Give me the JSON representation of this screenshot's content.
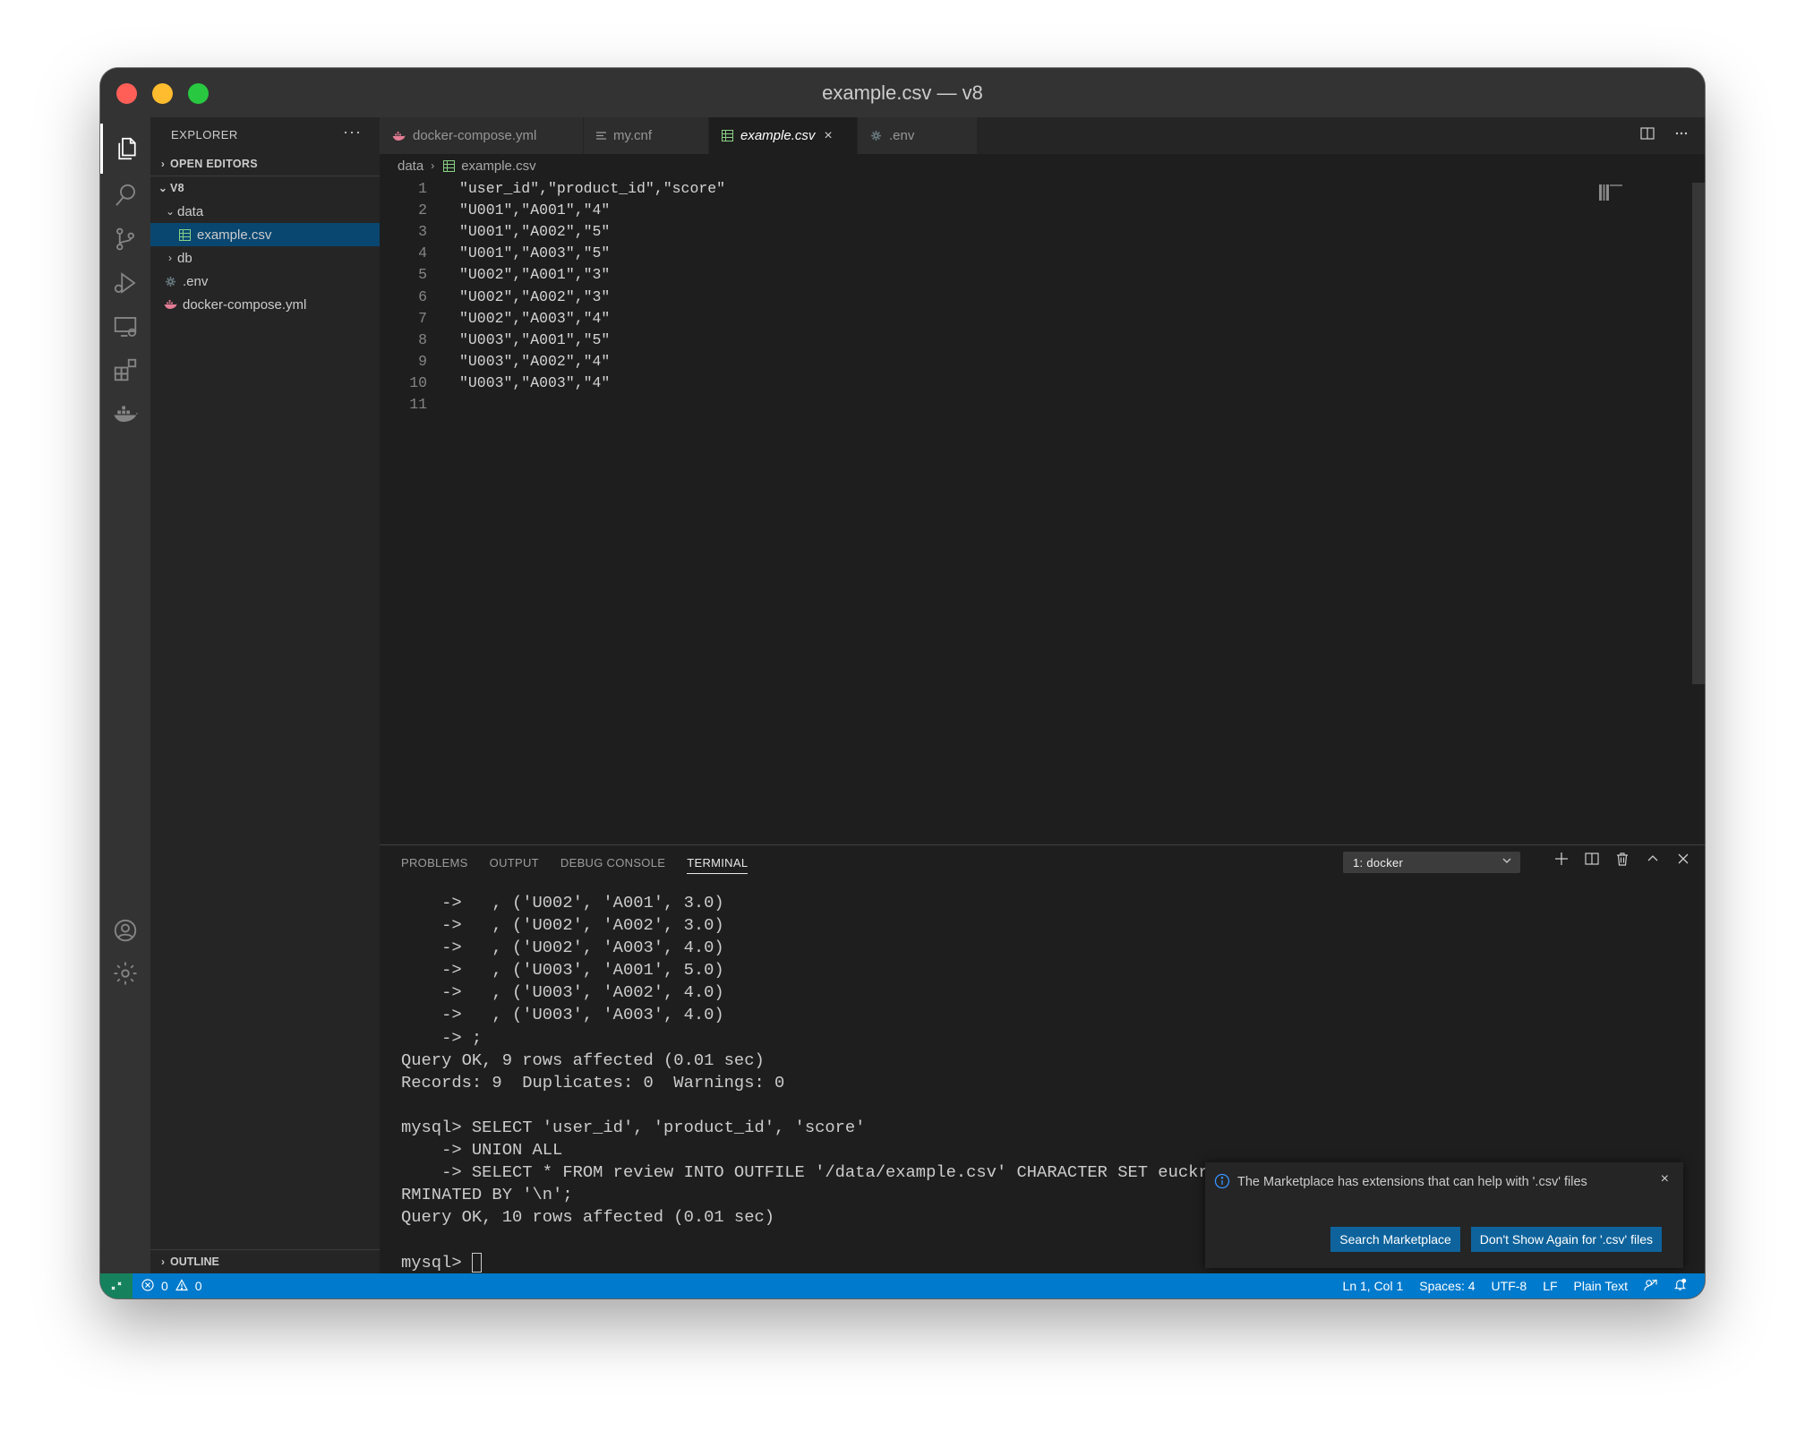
{
  "window": {
    "title": "example.csv — v8"
  },
  "sidebar": {
    "header": "EXPLORER",
    "more": "···",
    "open_editors": "OPEN EDITORS",
    "workspace": "V8",
    "tree": [
      {
        "label": "data",
        "type": "folder",
        "expanded": true
      },
      {
        "label": "example.csv",
        "type": "csv",
        "selected": true
      },
      {
        "label": "db",
        "type": "folder",
        "expanded": false
      },
      {
        "label": ".env",
        "type": "gear"
      },
      {
        "label": "docker-compose.yml",
        "type": "docker"
      }
    ],
    "outline": "OUTLINE"
  },
  "tabs": [
    {
      "label": "docker-compose.yml",
      "icon": "docker-icon"
    },
    {
      "label": "my.cnf",
      "icon": "lines-icon"
    },
    {
      "label": "example.csv",
      "icon": "csv-icon",
      "active": true,
      "close": "×"
    },
    {
      "label": ".env",
      "icon": "gear-icon"
    }
  ],
  "breadcrumb": {
    "folder": "data",
    "file": "example.csv"
  },
  "editor": {
    "lines": [
      {
        "n": "1",
        "text": "\"user_id\",\"product_id\",\"score\""
      },
      {
        "n": "2",
        "text": "\"U001\",\"A001\",\"4\""
      },
      {
        "n": "3",
        "text": "\"U001\",\"A002\",\"5\""
      },
      {
        "n": "4",
        "text": "\"U001\",\"A003\",\"5\""
      },
      {
        "n": "5",
        "text": "\"U002\",\"A001\",\"3\""
      },
      {
        "n": "6",
        "text": "\"U002\",\"A002\",\"3\""
      },
      {
        "n": "7",
        "text": "\"U002\",\"A003\",\"4\""
      },
      {
        "n": "8",
        "text": "\"U003\",\"A001\",\"5\""
      },
      {
        "n": "9",
        "text": "\"U003\",\"A002\",\"4\""
      },
      {
        "n": "10",
        "text": "\"U003\",\"A003\",\"4\""
      },
      {
        "n": "11",
        "text": ""
      }
    ]
  },
  "panel": {
    "tabs": [
      {
        "label": "PROBLEMS"
      },
      {
        "label": "OUTPUT"
      },
      {
        "label": "DEBUG CONSOLE"
      },
      {
        "label": "TERMINAL",
        "active": true
      }
    ],
    "terminal_select": "1: docker",
    "terminal_lines": [
      "    ->   , ('U002', 'A001', 3.0)",
      "    ->   , ('U002', 'A002', 3.0)",
      "    ->   , ('U002', 'A003', 4.0)",
      "    ->   , ('U003', 'A001', 5.0)",
      "    ->   , ('U003', 'A002', 4.0)",
      "    ->   , ('U003', 'A003', 4.0)",
      "    -> ;",
      "Query OK, 9 rows affected (0.01 sec)",
      "Records: 9  Duplicates: 0  Warnings: 0",
      "",
      "mysql> SELECT 'user_id', 'product_id', 'score'",
      "    -> UNION ALL",
      "    -> SELECT * FROM review INTO OUTFILE '/data/example.csv' CHARACTER SET euckr FIE",
      "RMINATED BY '\\n';",
      "Query OK, 10 rows affected (0.01 sec)",
      ""
    ],
    "prompt": "mysql> "
  },
  "notification": {
    "message": "The Marketplace has extensions that can help with '.csv' files",
    "button_search": "Search Marketplace",
    "button_dont_show": "Don't Show Again for '.csv' files",
    "close": "×"
  },
  "statusbar": {
    "errors": "0",
    "warnings": "0",
    "position": "Ln 1, Col 1",
    "spaces": "Spaces: 4",
    "encoding": "UTF-8",
    "eol": "LF",
    "language": "Plain Text"
  },
  "colors": {
    "accent": "#007acc",
    "selection": "#094771",
    "remote": "#16825d",
    "button": "#0e639c"
  }
}
